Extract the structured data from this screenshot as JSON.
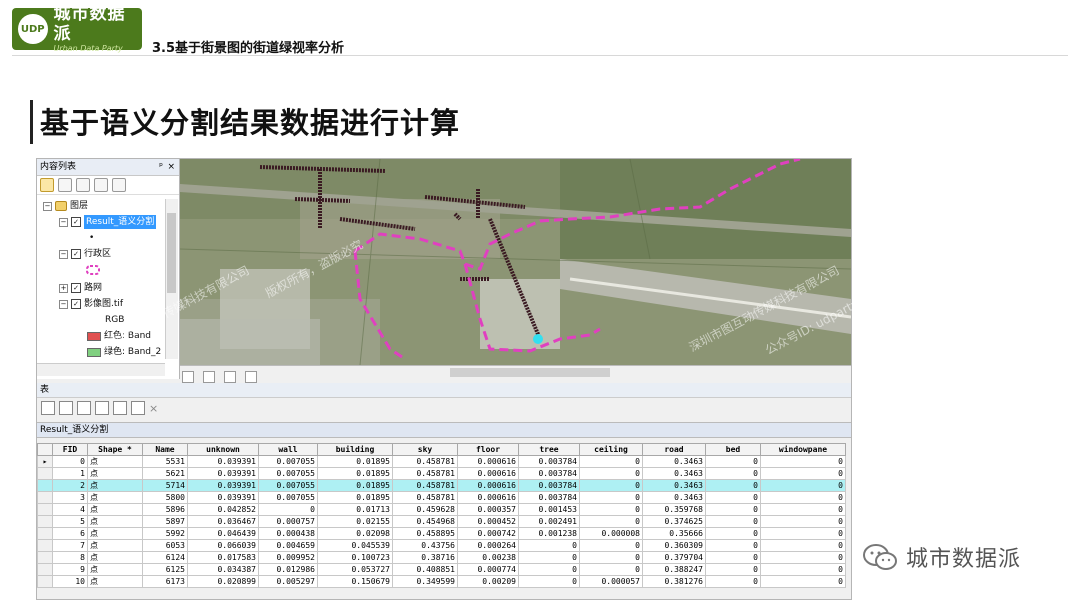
{
  "header": {
    "logo_name": "城市数据派",
    "logo_sub": "Urban Data Party",
    "logo_mark": "UDP",
    "section_title": "3.5基于街景图的街道绿视率分析",
    "main_title": "基于语义分割结果数据进行计算"
  },
  "toc": {
    "title": "内容列表",
    "pin": "ᵖ",
    "close": "×",
    "layers": [
      {
        "label": "图层",
        "level": 0
      },
      {
        "label": "Result_语义分割",
        "level": 1,
        "selected": true
      },
      {
        "label": "•",
        "level": 2
      },
      {
        "label": "行政区",
        "level": 1
      },
      {
        "label": "路网",
        "level": 1
      },
      {
        "label": "影像图.tif",
        "level": 1
      },
      {
        "label": "RGB",
        "level": 2
      },
      {
        "label": "红色: Band",
        "level": 2
      },
      {
        "label": "绿色: Band_2",
        "level": 2
      }
    ],
    "colors": {
      "red_band": "#e05050",
      "green_band": "#80d080"
    }
  },
  "table_panel": {
    "label": "表",
    "close_icon": "×",
    "table_name": "Result_语义分割",
    "columns": [
      "FID",
      "Shape *",
      "Name",
      "unknown",
      "wall",
      "building",
      "sky",
      "floor",
      "tree",
      "ceiling",
      "road",
      "bed",
      "windowpane"
    ],
    "rows": [
      [
        "0",
        "点",
        "5531",
        "0.039391",
        "0.007055",
        "0.01895",
        "0.458781",
        "0.000616",
        "0.003784",
        "0",
        "0.3463",
        "0",
        "0"
      ],
      [
        "1",
        "点",
        "5621",
        "0.039391",
        "0.007055",
        "0.01895",
        "0.458781",
        "0.000616",
        "0.003784",
        "0",
        "0.3463",
        "0",
        "0"
      ],
      [
        "2",
        "点",
        "5714",
        "0.039391",
        "0.007055",
        "0.01895",
        "0.458781",
        "0.000616",
        "0.003784",
        "0",
        "0.3463",
        "0",
        "0"
      ],
      [
        "3",
        "点",
        "5800",
        "0.039391",
        "0.007055",
        "0.01895",
        "0.458781",
        "0.000616",
        "0.003784",
        "0",
        "0.3463",
        "0",
        "0"
      ],
      [
        "4",
        "点",
        "5896",
        "0.042852",
        "0",
        "0.01713",
        "0.459628",
        "0.000357",
        "0.001453",
        "0",
        "0.359768",
        "0",
        "0"
      ],
      [
        "5",
        "点",
        "5897",
        "0.036467",
        "0.000757",
        "0.02155",
        "0.454968",
        "0.000452",
        "0.002491",
        "0",
        "0.374625",
        "0",
        "0"
      ],
      [
        "6",
        "点",
        "5992",
        "0.046439",
        "0.000438",
        "0.02098",
        "0.458895",
        "0.000742",
        "0.001238",
        "0.000008",
        "0.35666",
        "0",
        "0"
      ],
      [
        "7",
        "点",
        "6053",
        "0.066039",
        "0.004659",
        "0.045539",
        "0.43756",
        "0.000264",
        "0",
        "0",
        "0.360309",
        "0",
        "0"
      ],
      [
        "8",
        "点",
        "6124",
        "0.017583",
        "0.009952",
        "0.100723",
        "0.38716",
        "0.00238",
        "0",
        "0",
        "0.379704",
        "0",
        "0"
      ],
      [
        "9",
        "点",
        "6125",
        "0.034387",
        "0.012986",
        "0.053727",
        "0.408851",
        "0.000774",
        "0",
        "0",
        "0.388247",
        "0",
        "0"
      ],
      [
        "10",
        "点",
        "6173",
        "0.020899",
        "0.005297",
        "0.150679",
        "0.349599",
        "0.00209",
        "0",
        "0.000057",
        "0.381276",
        "0",
        "0"
      ]
    ],
    "highlighted_row": 2
  },
  "watermarks": [
    "深圳市图互动传媒科技有限公司",
    "版权所有，盗版必究",
    "公众号ID: udparty",
    "深圳市图互动传媒科技有限公司"
  ],
  "footer": {
    "wechat_name": "城市数据派"
  },
  "colors": {
    "accent": "#4c7a1c",
    "boundary": "#e040c0",
    "highlight_row": "#aef0f3"
  }
}
